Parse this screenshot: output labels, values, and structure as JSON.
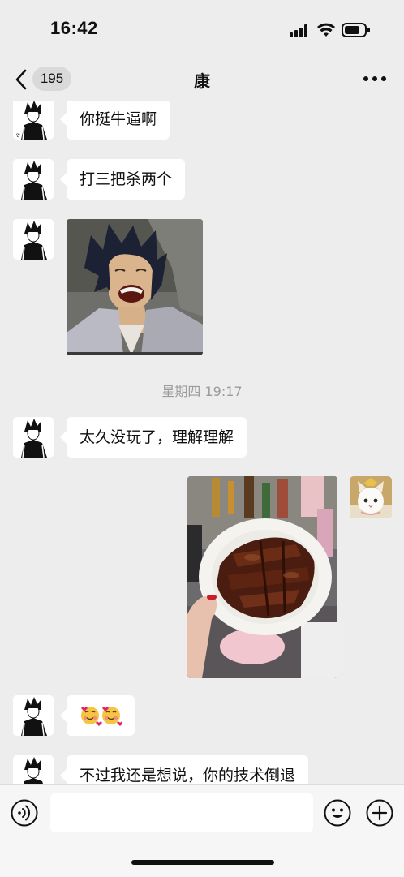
{
  "status_bar": {
    "time": "16:42"
  },
  "nav": {
    "back_count": "195",
    "title": "康"
  },
  "messages": [
    {
      "type": "text",
      "sender": "other",
      "text": "你挺牛逼啊"
    },
    {
      "type": "text",
      "sender": "other",
      "text": "打三把杀两个"
    },
    {
      "type": "image",
      "sender": "other",
      "image": "laughing-anime-sticker"
    },
    {
      "type": "timestamp",
      "text": "星期四 19:17"
    },
    {
      "type": "text",
      "sender": "other",
      "text": "太久没玩了，理解理解"
    },
    {
      "type": "image",
      "sender": "me",
      "image": "braised-ribs-photo"
    },
    {
      "type": "text",
      "sender": "other",
      "text": "🥰🥰"
    },
    {
      "type": "text",
      "sender": "other",
      "text": "不过我还是想说，你的技术倒退"
    }
  ],
  "input_bar": {
    "voice_icon": "voice-icon",
    "emoji_icon": "emoji-icon",
    "plus_icon": "plus-icon"
  },
  "colors": {
    "background": "#ededed",
    "bubble": "#ffffff",
    "accent": "#111111"
  }
}
